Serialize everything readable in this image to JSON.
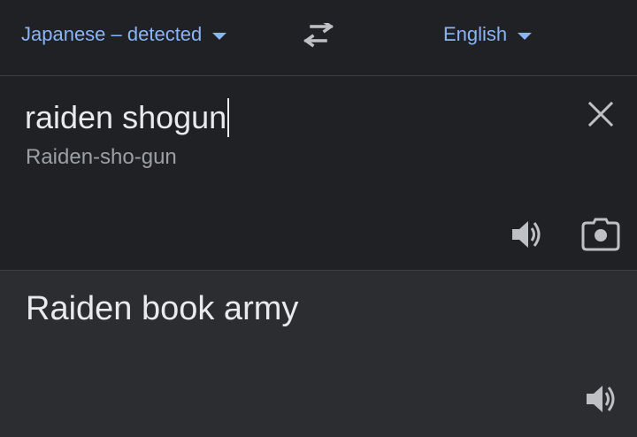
{
  "language_bar": {
    "source_language": "Japanese – detected",
    "target_language": "English"
  },
  "input": {
    "text": "raiden shogun",
    "transliteration": "Raiden-sho-gun"
  },
  "output": {
    "translation": "Raiden book army"
  },
  "icons": {
    "swap": "swap-arrows-icon",
    "clear": "close-icon",
    "speak_source": "speaker-icon",
    "camera": "camera-icon",
    "speak_output": "speaker-icon"
  },
  "colors": {
    "background": "#202124",
    "output_background": "#2c2d30",
    "accent": "#8ab4f8",
    "text_primary": "#e8eaed",
    "text_secondary": "#9aa0a6",
    "icon": "#bdc1c6"
  }
}
